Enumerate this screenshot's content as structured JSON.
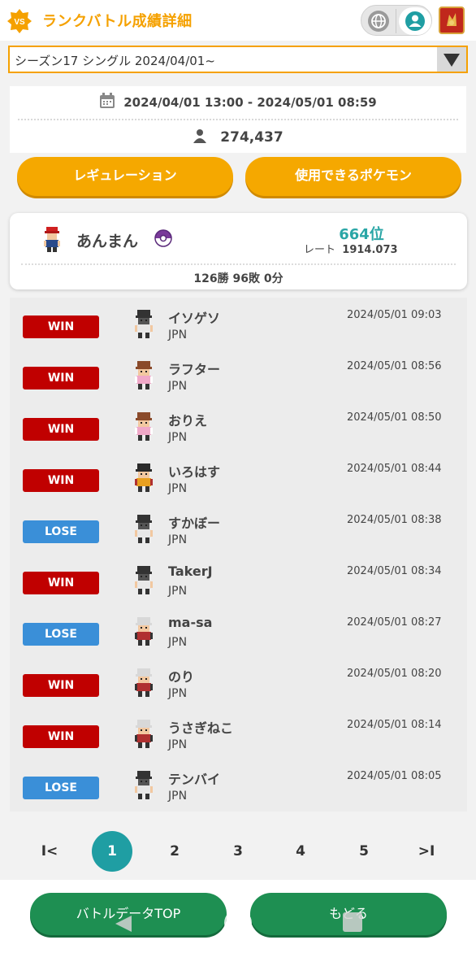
{
  "header": {
    "badge": "VS",
    "title": "ランクバトル成績詳細"
  },
  "season_select": {
    "value": "シーズン17 シングル 2024/04/01~"
  },
  "info": {
    "period": "2024/04/01 13:00 - 2024/05/01 08:59",
    "players": "274,437"
  },
  "buttons": {
    "regulation": "レギュレーション",
    "usable_pokemon": "使用できるポケモン"
  },
  "player": {
    "name": "あんまん",
    "rank": "664位",
    "rate_label": "レート",
    "rate_value": "1914.073",
    "record": "126勝 96敗 0分"
  },
  "battles": [
    {
      "result": "WIN",
      "name": "イソゲソ",
      "country": "JPN",
      "time": "2024/05/01 09:03",
      "sprite": "trainer-dark-icon"
    },
    {
      "result": "WIN",
      "name": "ラフター",
      "country": "JPN",
      "time": "2024/05/01 08:56",
      "sprite": "trainer-pink-icon"
    },
    {
      "result": "WIN",
      "name": "おりえ",
      "country": "JPN",
      "time": "2024/05/01 08:50",
      "sprite": "trainer-pink-icon"
    },
    {
      "result": "WIN",
      "name": "いろはす",
      "country": "JPN",
      "time": "2024/05/01 08:44",
      "sprite": "trainer-gold-icon"
    },
    {
      "result": "LOSE",
      "name": "すかぼー",
      "country": "JPN",
      "time": "2024/05/01 08:38",
      "sprite": "trainer-dark-icon"
    },
    {
      "result": "WIN",
      "name": "TakerJ",
      "country": "JPN",
      "time": "2024/05/01 08:34",
      "sprite": "trainer-dark-icon"
    },
    {
      "result": "LOSE",
      "name": "ma-sa",
      "country": "JPN",
      "time": "2024/05/01 08:27",
      "sprite": "trainer-red-icon"
    },
    {
      "result": "WIN",
      "name": "のり",
      "country": "JPN",
      "time": "2024/05/01 08:20",
      "sprite": "trainer-red-icon"
    },
    {
      "result": "WIN",
      "name": "うさぎねこ",
      "country": "JPN",
      "time": "2024/05/01 08:14",
      "sprite": "trainer-red-icon"
    },
    {
      "result": "LOSE",
      "name": "テンバイ",
      "country": "JPN",
      "time": "2024/05/01 08:05",
      "sprite": "trainer-dark-icon"
    }
  ],
  "pagination": {
    "first": "I<",
    "pages": [
      "1",
      "2",
      "3",
      "4",
      "5"
    ],
    "last": ">I",
    "current": "1"
  },
  "bottom": {
    "battle_top": "バトルデータTOP",
    "back": "もどる"
  },
  "colors": {
    "accent": "#f5a100",
    "win": "#c00000",
    "lose": "#3a8fd8",
    "rank": "#2aa6a6",
    "green": "#1e8f52"
  }
}
